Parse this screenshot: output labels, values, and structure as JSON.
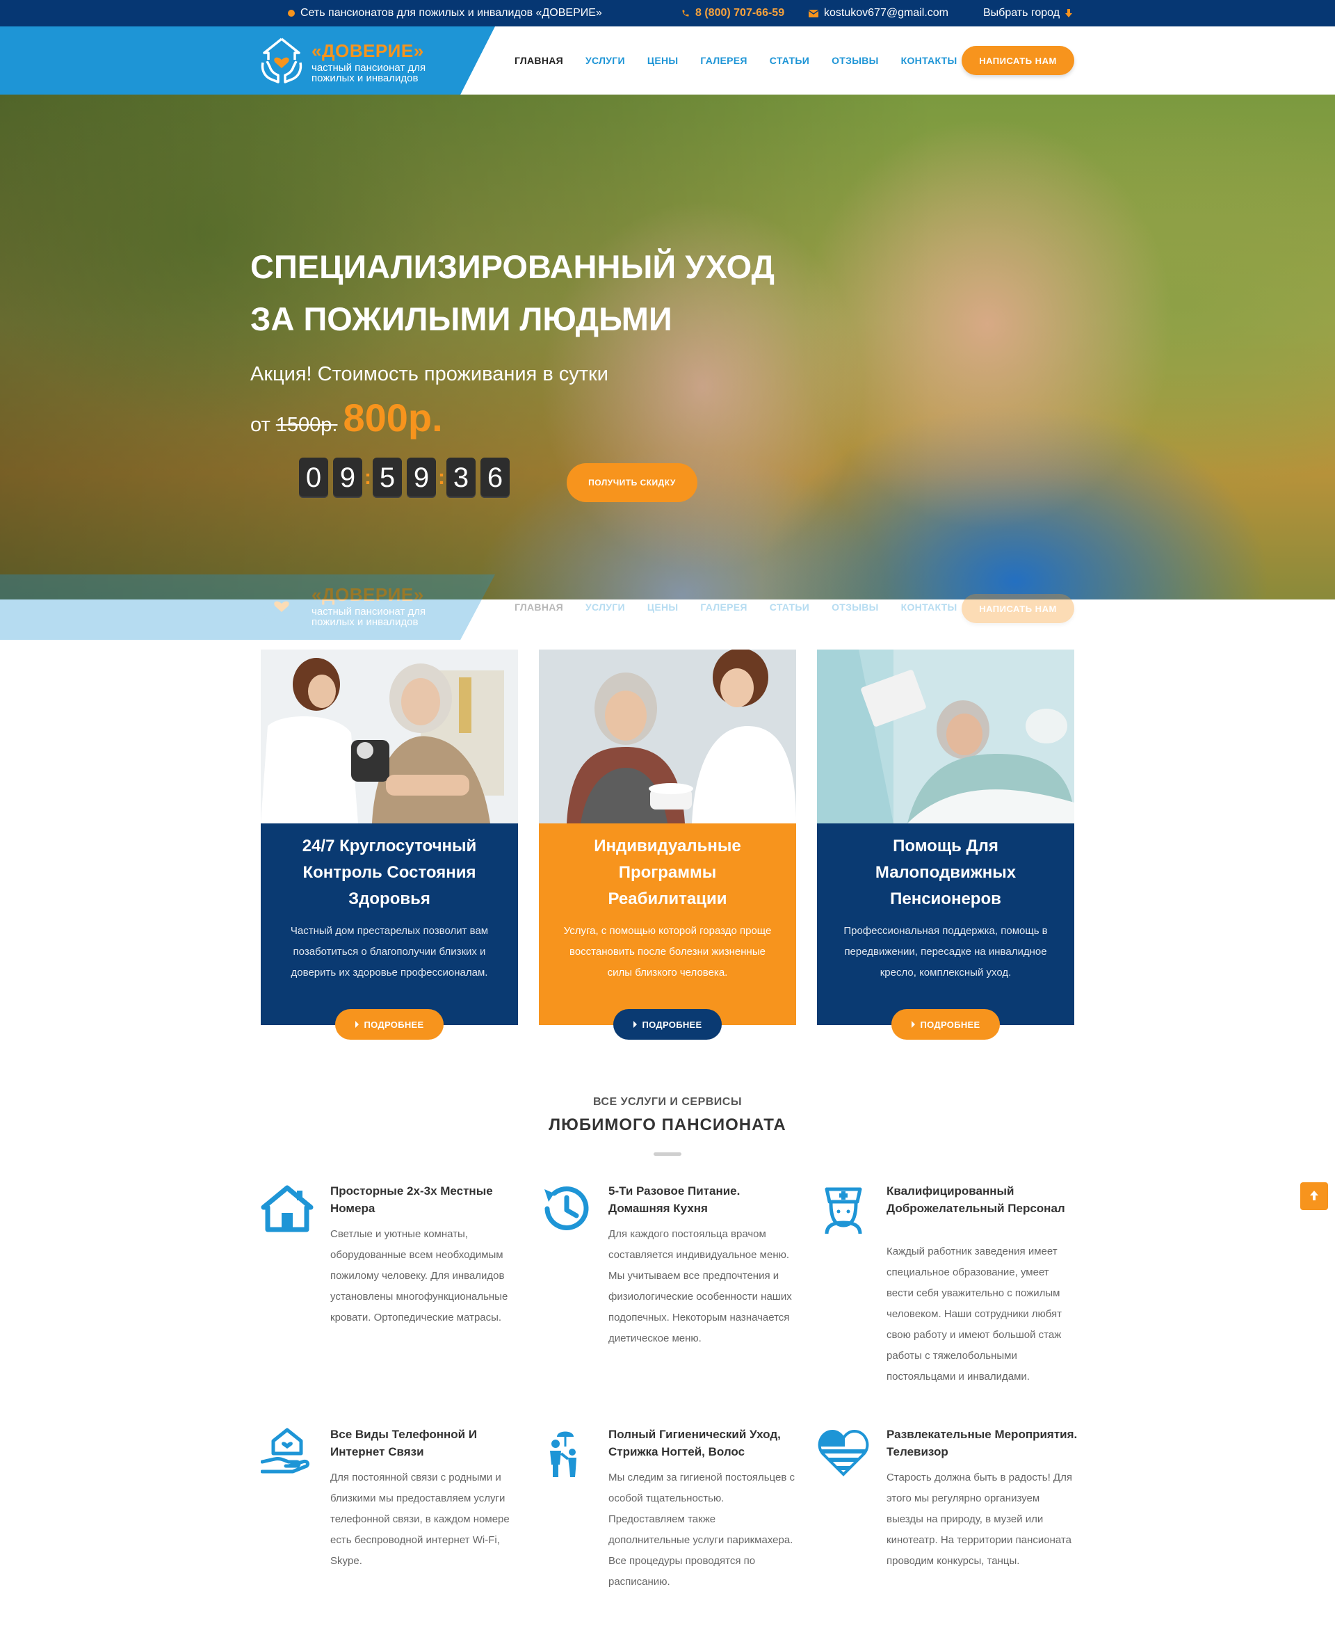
{
  "topbar": {
    "network": "Сеть пансионатов для пожилых и инвалидов «ДОВЕРИЕ»",
    "phone": "8 (800) 707-66-59",
    "email": "kostukov677@gmail.com",
    "city": "Выбрать город"
  },
  "brand": {
    "name": "«ДОВЕРИЕ»",
    "sub1": "частный пансионат для",
    "sub2": "пожилых и инвалидов"
  },
  "nav": {
    "items": [
      "ГЛАВНАЯ",
      "УСЛУГИ",
      "ЦЕНЫ",
      "ГАЛЕРЕЯ",
      "СТАТЬИ",
      "ОТЗЫВЫ",
      "КОНТАКТЫ"
    ],
    "cta": "НАПИСАТЬ НАМ"
  },
  "hero": {
    "title1": "СПЕЦИАЛИЗИРОВАННЫЙ УХОД",
    "title2": "ЗА ПОЖИЛЫМИ ЛЮДЬМИ",
    "promo": "Акция! Стоимость проживания в сутки",
    "from": "от",
    "old_price": "1500р.",
    "new_price": "800р.",
    "timer": [
      "0",
      "9",
      "5",
      "9",
      "3",
      "6"
    ],
    "button": "ПОЛУЧИТЬ СКИДКУ"
  },
  "cards": [
    {
      "title": "24/7 Круглосуточный Контроль Состояния Здоровья",
      "text": "Частный дом престарелых позволит вам позаботиться о благополучии близких и доверить их здоровье профессионалам.",
      "button": "ПОДРОБНЕЕ",
      "color": "#0a3a72"
    },
    {
      "title": "Индивидуальные Программы Реабилитации",
      "text": "Услуга, с помощью которой гораздо проще восстановить после болезни жизненные силы близкого человека.",
      "button": "ПОДРОБНЕЕ",
      "color": "#f7941d"
    },
    {
      "title": "Помощь Для Малоподвижных Пенсионеров",
      "text": "Профессиональная поддержка, помощь в передвижении, пересадке на инвалидное кресло, комплексный уход.",
      "button": "ПОДРОБНЕЕ",
      "color": "#0a3a72"
    }
  ],
  "services": {
    "subtitle": "ВСЕ УСЛУГИ И СЕРВИСЫ",
    "title": "ЛЮБИМОГО ПАНСИОНАТА",
    "items": [
      {
        "icon": "house-icon",
        "title": "Просторные 2х-3х Местные Номера",
        "text": "Светлые и уютные комнаты, оборудованные всем необходимым пожилому человеку. Для инвалидов установлены многофункциональные кровати. Ортопедические матрасы."
      },
      {
        "icon": "clock-history-icon",
        "title": "5-Ти Разовое Питание. Домашняя Кухня",
        "text": "Для каждого постояльца врачом составляется индивидуальное меню. Мы учитываем все предпочтения и физиологические особенности наших подопечных. Некоторым назначается диетическое меню."
      },
      {
        "icon": "nurse-icon",
        "title": "Квалифицированный Доброжелательный Персонал",
        "text": "Каждый работник заведения имеет специальное образование, умеет вести себя уважительно с пожилым человеком. Наши сотрудники любят свою работу и имеют большой стаж работы с тяжелобольными постояльцами и инвалидами."
      },
      {
        "icon": "hand-house-heart-icon",
        "title": "Все Виды Телефонной И Интернет Связи",
        "text": "Для постоянной связи с родными и близкими мы предоставляем услуги телефонной связи, в каждом номере есть беспроводной интернет Wi-Fi, Skype."
      },
      {
        "icon": "family-umbrella-icon",
        "title": "Полный Гигиенический Уход, Стрижка Ногтей, Волос",
        "text": "Мы следим за гигиеной постояльцев с особой тщательностью. Предоставляем также дополнительные услуги парикмахера. Все процедуры проводятся по расписанию."
      },
      {
        "icon": "heart-stripes-icon",
        "title": "Развлекательные Мероприятия. Телевизор",
        "text": "Старость должна быть в радость! Для этого мы регулярно организуем выезды на природу, в музей или кинотеатр. На территории пансионата проводим конкурсы, танцы."
      }
    ]
  }
}
